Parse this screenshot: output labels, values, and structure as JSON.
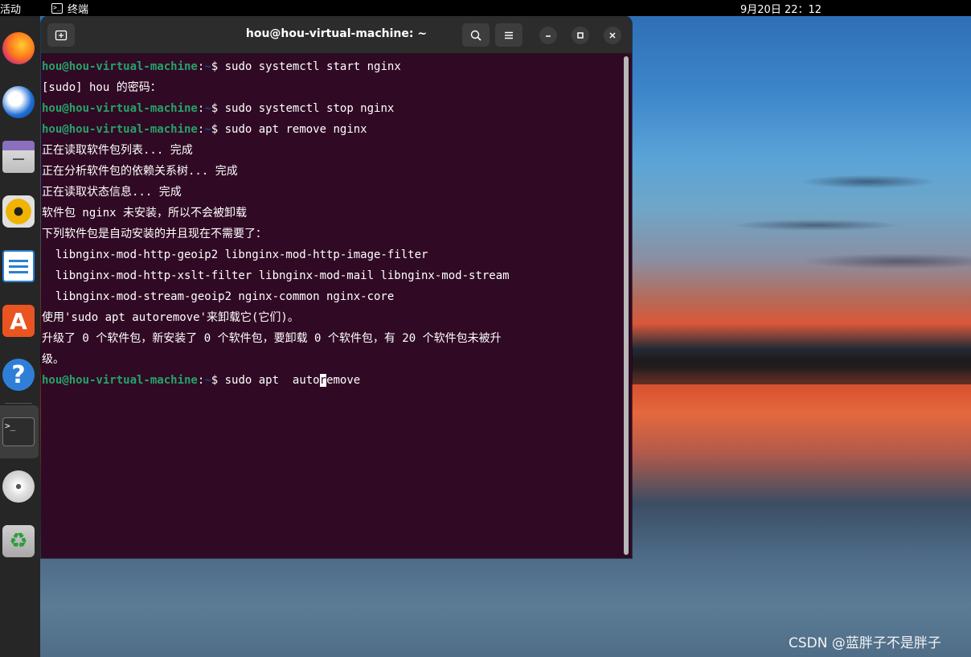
{
  "topbar": {
    "activities": "活动",
    "app_name": "终端",
    "app_icon": "terminal-icon",
    "clock": "9月20日  22：12"
  },
  "dock": {
    "items": [
      {
        "name": "firefox",
        "icon": "firefox-icon"
      },
      {
        "name": "thunderbird",
        "icon": "thunderbird-icon"
      },
      {
        "name": "files",
        "icon": "files-icon"
      },
      {
        "name": "rhythmbox",
        "icon": "rhythmbox-icon"
      },
      {
        "name": "libreoffice-writer",
        "icon": "writer-icon"
      },
      {
        "name": "app-center",
        "icon": "store-icon",
        "glyph": "A"
      },
      {
        "name": "help",
        "icon": "help-icon",
        "glyph": "?"
      },
      {
        "name": "terminal",
        "icon": "terminal-icon",
        "glyph": ">_",
        "active": true
      },
      {
        "name": "dvd",
        "icon": "dvd-icon"
      },
      {
        "name": "trash",
        "icon": "trash-icon",
        "glyph": "♻"
      }
    ]
  },
  "window": {
    "title": "hou@hou-virtual-machine: ~",
    "new_tab_icon": "new-tab-icon",
    "search_icon": "search-icon",
    "menu_icon": "hamburger-menu-icon",
    "minimize_icon": "minimize-icon",
    "maximize_icon": "maximize-icon",
    "close_icon": "close-icon"
  },
  "terminal": {
    "prompt_user": "hou@hou-virtual-machine",
    "prompt_sep": ":",
    "prompt_path": "~",
    "prompt_end": "$ ",
    "lines": [
      {
        "type": "cmd",
        "text": "sudo systemctl start nginx"
      },
      {
        "type": "out",
        "text": "[sudo] hou 的密码："
      },
      {
        "type": "cmd",
        "text": "sudo systemctl stop nginx"
      },
      {
        "type": "cmd",
        "text": "sudo apt remove nginx"
      },
      {
        "type": "out",
        "text": "正在读取软件包列表... 完成"
      },
      {
        "type": "out",
        "text": "正在分析软件包的依赖关系树... 完成"
      },
      {
        "type": "out",
        "text": "正在读取状态信息... 完成"
      },
      {
        "type": "out",
        "text": "软件包 nginx 未安装，所以不会被卸载"
      },
      {
        "type": "out",
        "text": "下列软件包是自动安装的并且现在不需要了："
      },
      {
        "type": "out",
        "text": "  libnginx-mod-http-geoip2 libnginx-mod-http-image-filter"
      },
      {
        "type": "out",
        "text": "  libnginx-mod-http-xslt-filter libnginx-mod-mail libnginx-mod-stream"
      },
      {
        "type": "out",
        "text": "  libnginx-mod-stream-geoip2 nginx-common nginx-core"
      },
      {
        "type": "out",
        "text": "使用'sudo apt autoremove'来卸载它(它们)。"
      },
      {
        "type": "out",
        "text": "升级了 0 个软件包，新安装了 0 个软件包，要卸载 0 个软件包，有 20 个软件包未被升"
      },
      {
        "type": "out",
        "text": "级。"
      }
    ],
    "current_input_before": "sudo apt  auto",
    "current_input_cursor": "r",
    "current_input_after": "emove"
  },
  "watermark": "CSDN @蓝胖子不是胖子"
}
